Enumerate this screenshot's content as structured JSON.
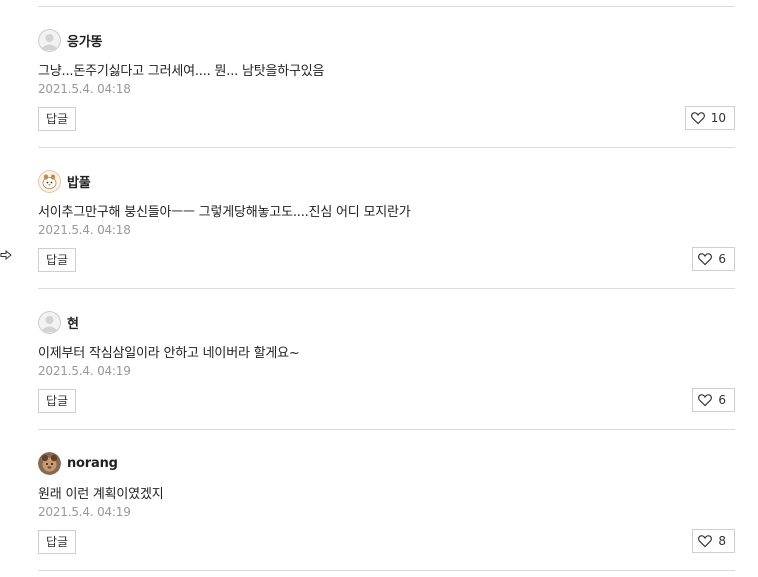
{
  "comments": [
    {
      "author": "응가똥",
      "avatar_icon": "default-user-avatar",
      "text": "그냥...돈주기싫다고 그러세여.... 뭔... 남탓을하구있음",
      "time": "2021.5.4. 04:18",
      "reply_label": "답글",
      "likes": "10"
    },
    {
      "author": "밥풀",
      "avatar_icon": "character-avatar",
      "text": "서이추그만구해 붕신들아ㅡㅡ 그렇게당해놓고도....진심 어디 모지란가",
      "time": "2021.5.4. 04:18",
      "reply_label": "답글",
      "likes": "6"
    },
    {
      "author": "현",
      "avatar_icon": "default-user-avatar",
      "text": "이제부터 작심삼일이라 안하고 네이버라 할게요~",
      "time": "2021.5.4. 04:19",
      "reply_label": "답글",
      "likes": "6"
    },
    {
      "author": "norang",
      "avatar_icon": "photo-avatar",
      "text": "원래 이런 계획이였겠지",
      "time": "2021.5.4. 04:19",
      "reply_label": "답글",
      "likes": "8"
    }
  ],
  "colors": {
    "divider": "#dcdcdc",
    "time_text": "#999999",
    "button_border": "#cfcfcf"
  }
}
